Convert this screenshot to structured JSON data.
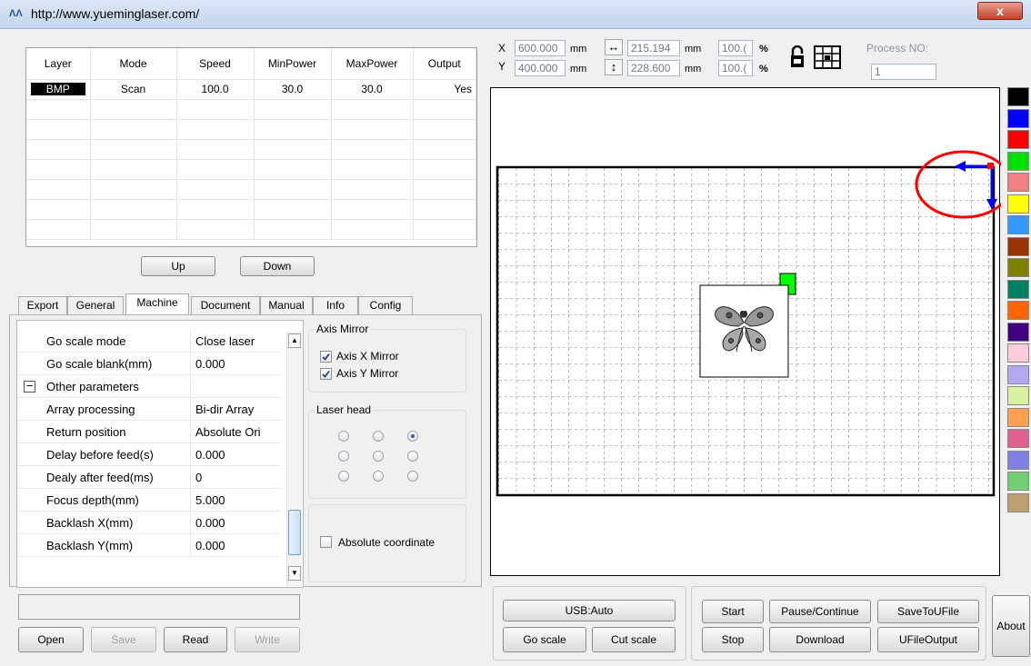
{
  "window": {
    "url_title": "http://www.yueminglaser.com/",
    "close_label": "x"
  },
  "layers": {
    "headers": [
      "Layer",
      "Mode",
      "Speed",
      "MinPower",
      "MaxPower",
      "Output"
    ],
    "rows": [
      {
        "layer": "BMP",
        "mode": "Scan",
        "speed": "100.0",
        "minpower": "30.0",
        "maxpower": "30.0",
        "output": "Yes"
      }
    ],
    "up_label": "Up",
    "down_label": "Down"
  },
  "tabs": [
    "Export",
    "General",
    "Machine",
    "Document",
    "Manual",
    "Info",
    "Config"
  ],
  "active_tab": "Machine",
  "properties": [
    {
      "key": "Go scale mode",
      "value": "Close laser"
    },
    {
      "key": "Go scale blank(mm)",
      "value": "0.000"
    },
    {
      "key": "Other parameters",
      "value": ""
    },
    {
      "key": "Array processing",
      "value": "Bi-dir Array"
    },
    {
      "key": "Return position",
      "value": "Absolute Ori"
    },
    {
      "key": "Delay before feed(s)",
      "value": "0.000"
    },
    {
      "key": "Dealy after feed(ms)",
      "value": "0"
    },
    {
      "key": "Focus depth(mm)",
      "value": "5.000"
    },
    {
      "key": "Backlash X(mm)",
      "value": "0.000"
    },
    {
      "key": "Backlash Y(mm)",
      "value": "0.000"
    }
  ],
  "collapse_symbol": "−",
  "axis_mirror": {
    "title": "Axis Mirror",
    "x_label": "Axis X Mirror",
    "y_label": "Axis Y Mirror",
    "x_checked": true,
    "y_checked": true
  },
  "laser_head": {
    "title": "Laser head",
    "selected_index": 2
  },
  "absolute_coordinate_label": "Absolute coordinate",
  "file_buttons": {
    "open": "Open",
    "save": "Save",
    "read": "Read",
    "write": "Write"
  },
  "toolbar": {
    "x_label": "X",
    "y_label": "Y",
    "x_value": "600.000",
    "y_value": "400.000",
    "unit": "mm",
    "width_value": "215.194",
    "height_value": "228.600",
    "scale_x": "100.(",
    "scale_y": "100.(",
    "percent": "%",
    "process_label": "Process NO:",
    "process_value": "1"
  },
  "controls": {
    "usb": "USB:Auto",
    "go_scale": "Go scale",
    "cut_scale": "Cut scale",
    "start": "Start",
    "pause": "Pause/Continue",
    "save_to_ufile": "SaveToUFile",
    "stop": "Stop",
    "download": "Download",
    "ufile_output": "UFileOutput",
    "about": "About"
  },
  "colors": [
    "#000000",
    "#0000ff",
    "#ff0000",
    "#00e000",
    "#f08080",
    "#ffff00",
    "#3399ff",
    "#993300",
    "#808000",
    "#008060",
    "#ff6600",
    "#400080",
    "#ffccdd",
    "#b0a8f0",
    "#d8f0a0",
    "#ffa050",
    "#e06090",
    "#8080e0",
    "#70d070",
    "#c0a070"
  ],
  "accent_colors": {
    "origin_marker": "#00ff00",
    "arrow": "#0000ff",
    "highlight_circle": "#ff0000"
  }
}
